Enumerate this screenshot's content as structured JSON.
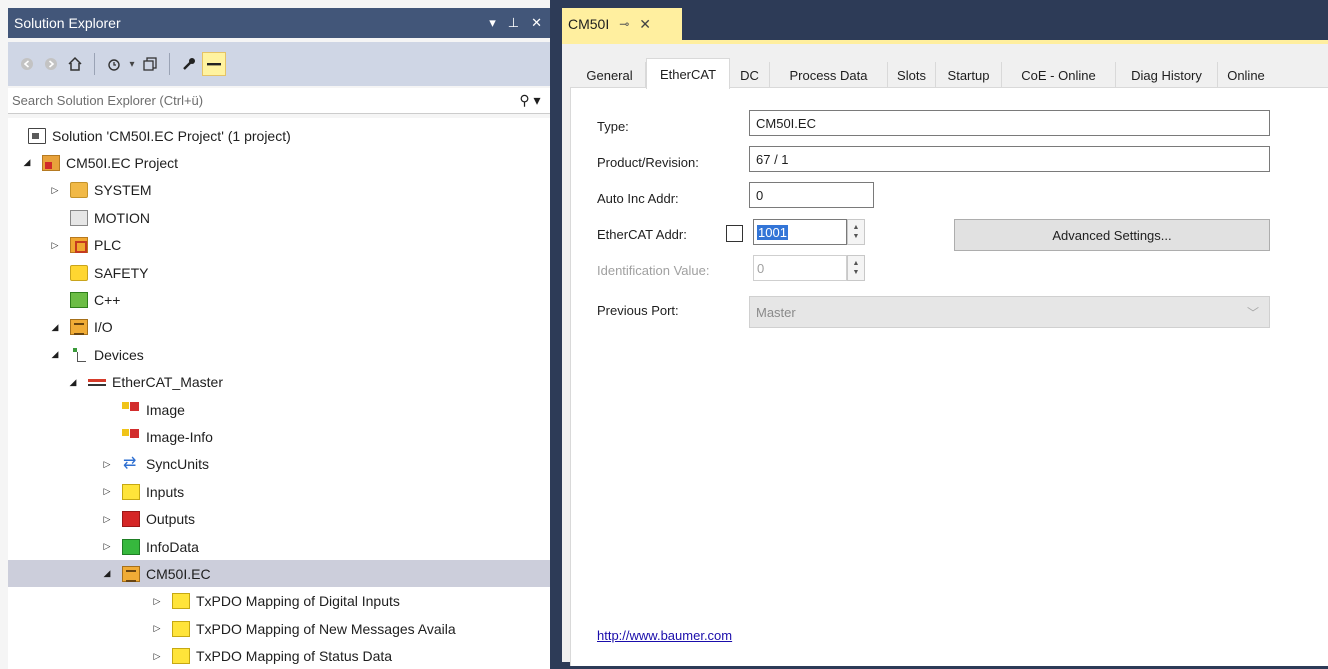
{
  "solution_explorer": {
    "title": "Solution Explorer",
    "title_buttons": {
      "dropdown": "▾",
      "pin": "⊥",
      "close": "✕"
    },
    "search_placeholder": "Search Solution Explorer (Ctrl+ü)",
    "search_icon": "search-icon",
    "toolbar_icons": [
      "back-icon",
      "forward-icon",
      "home-icon",
      "history-icon",
      "dropdown-icon",
      "sync-views-icon",
      "properties-icon",
      "preview-icon"
    ],
    "tree": [
      {
        "label": "Solution 'CM50I.EC Project' (1 project)",
        "icon": "solution-icon",
        "twisty": "",
        "level": 0
      },
      {
        "label": "CM50I.EC Project",
        "icon": "project-icon",
        "twisty": "◢",
        "level": 0
      },
      {
        "label": "SYSTEM",
        "icon": "system-icon",
        "twisty": "▷",
        "level": 1
      },
      {
        "label": "MOTION",
        "icon": "motion-icon",
        "twisty": "",
        "level": 1
      },
      {
        "label": "PLC",
        "icon": "plc-icon",
        "twisty": "▷",
        "level": 1
      },
      {
        "label": "SAFETY",
        "icon": "safety-icon",
        "twisty": "",
        "level": 1
      },
      {
        "label": "C++",
        "icon": "cpp-icon",
        "twisty": "",
        "level": 1
      },
      {
        "label": "I/O",
        "icon": "io-icon",
        "twisty": "◢",
        "level": 1
      },
      {
        "label": "Devices",
        "icon": "devices-icon",
        "twisty": "◢",
        "level": 2
      },
      {
        "label": "EtherCAT_Master",
        "icon": "ethercat-master-icon",
        "twisty": "◢",
        "level": 3
      },
      {
        "label": "Image",
        "icon": "image-icon",
        "twisty": "",
        "level": 4
      },
      {
        "label": "Image-Info",
        "icon": "image-info-icon",
        "twisty": "",
        "level": 4
      },
      {
        "label": "SyncUnits",
        "icon": "syncunits-icon",
        "twisty": "▷",
        "level": 4
      },
      {
        "label": "Inputs",
        "icon": "inputs-icon",
        "twisty": "▷",
        "level": 4
      },
      {
        "label": "Outputs",
        "icon": "outputs-icon",
        "twisty": "▷",
        "level": 4
      },
      {
        "label": "InfoData",
        "icon": "infodata-icon",
        "twisty": "▷",
        "level": 4
      },
      {
        "label": "CM50I.EC",
        "icon": "box-icon",
        "twisty": "◢",
        "level": 4,
        "selected": true
      },
      {
        "label": "TxPDO Mapping of Digital Inputs",
        "icon": "pdo-icon",
        "twisty": "▷",
        "level": 5
      },
      {
        "label": "TxPDO Mapping of New Messages Availa",
        "icon": "pdo-icon",
        "twisty": "▷",
        "level": 5
      },
      {
        "label": "TxPDO Mapping of Status Data",
        "icon": "pdo-icon",
        "twisty": "▷",
        "level": 5
      }
    ]
  },
  "document": {
    "tab_title": "CM50I",
    "tab_pin": "⊸",
    "tab_close": "✕",
    "tabs": [
      {
        "label": "General",
        "active": false
      },
      {
        "label": "EtherCAT",
        "active": true
      },
      {
        "label": "DC",
        "active": false
      },
      {
        "label": "Process Data",
        "active": false
      },
      {
        "label": "Slots",
        "active": false
      },
      {
        "label": "Startup",
        "active": false
      },
      {
        "label": "CoE - Online",
        "active": false
      },
      {
        "label": "Diag History",
        "active": false
      },
      {
        "label": "Online",
        "active": false
      }
    ],
    "fields": {
      "type_label": "Type:",
      "type_value": "CM50I.EC",
      "product_label": "Product/Revision:",
      "product_value": "67 / 1",
      "autoinc_label": "Auto Inc Addr:",
      "autoinc_value": "0",
      "ethercat_addr_label": "EtherCAT Addr:",
      "ethercat_addr_value": "1001",
      "ethercat_addr_checked": false,
      "ident_label": "Identification Value:",
      "ident_value": "0",
      "prev_port_label": "Previous Port:",
      "prev_port_value": "Master"
    },
    "advanced_button": "Advanced Settings...",
    "link": "http://www.baumer.com"
  },
  "colors": {
    "title_bar": "#425679",
    "toolbar": "#cfd6e5",
    "tab_active": "#ffef9f",
    "selection": "#cccedb",
    "frame": "#2d3b57"
  }
}
